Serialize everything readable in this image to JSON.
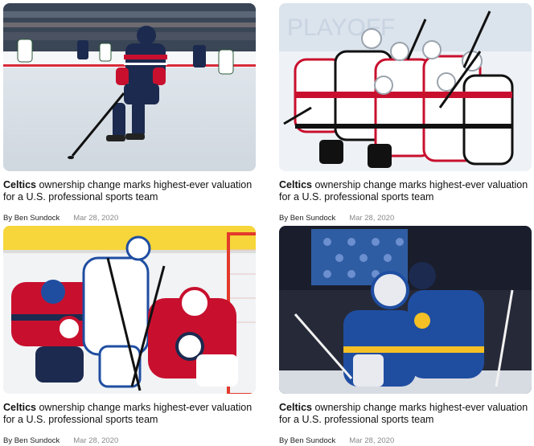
{
  "articles": [
    {
      "image_alt": "hockey-player-skating-with-puck",
      "headline_strong": "Celtics",
      "headline_rest": " ownership change marks highest-ever valuation for a U.S. professional sports team",
      "author": "By Ben Sundock",
      "date": "Mar 28, 2020"
    },
    {
      "image_alt": "team-celebration-huddle",
      "headline_strong": "Celtics",
      "headline_rest": " ownership change marks highest-ever valuation for a U.S. professional sports team",
      "author": "By Ben Sundock",
      "date": "Mar 28, 2020"
    },
    {
      "image_alt": "players-battling-in-front-of-goalie",
      "headline_strong": "Celtics",
      "headline_rest": " ownership change marks highest-ever valuation for a U.S. professional sports team",
      "author": "By Ben Sundock",
      "date": "Mar 28, 2020"
    },
    {
      "image_alt": "goalie-and-teammate-embrace",
      "headline_strong": "Celtics",
      "headline_rest": " ownership change marks highest-ever valuation for a U.S. professional sports team",
      "author": "By Ben Sundock",
      "date": "Mar 28, 2020"
    }
  ],
  "colors": {
    "ice": "#eef2f6",
    "navy": "#1c2a4f",
    "red": "#c8102e",
    "white": "#ffffff",
    "blues_blue": "#1f4ea1",
    "blues_yellow": "#f4c025"
  }
}
